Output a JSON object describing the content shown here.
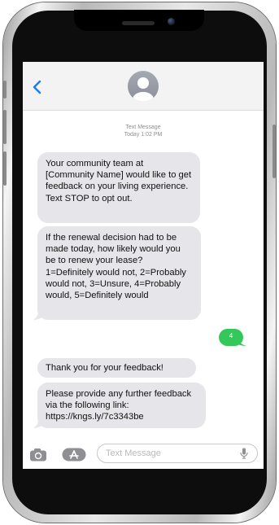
{
  "header": {
    "back_icon": "chevron-left-icon",
    "avatar_icon": "person-silhouette-icon",
    "accent_color": "#1a7cf5"
  },
  "conversation": {
    "meta_label": "Text Message",
    "meta_time": "Today 1:02 PM",
    "messages": [
      {
        "direction": "incoming",
        "text": "Your community team at [Community Name] would like to get feedback on your living experience. Text STOP to opt out."
      },
      {
        "direction": "incoming",
        "text": "If the renewal decision had to be made today, how likely would you be to renew your lease? 1=Definitely would not, 2=Probably would not, 3=Unsure, 4=Probably would, 5=Definitely would"
      },
      {
        "direction": "outgoing",
        "text": "4"
      },
      {
        "direction": "incoming",
        "text": "Thank you for your feedback!"
      },
      {
        "direction": "incoming",
        "text": "Please provide any further feedback via the following link: https://kngs.ly/7c3343be"
      }
    ]
  },
  "input_bar": {
    "camera_icon": "camera-icon",
    "apps_icon": "app-store-icon",
    "placeholder": "Text Message",
    "value": "",
    "mic_icon": "microphone-icon"
  },
  "colors": {
    "incoming_bubble": "#e5e5ea",
    "outgoing_bubble": "#34c759",
    "header_bg": "#f3f3f4"
  }
}
